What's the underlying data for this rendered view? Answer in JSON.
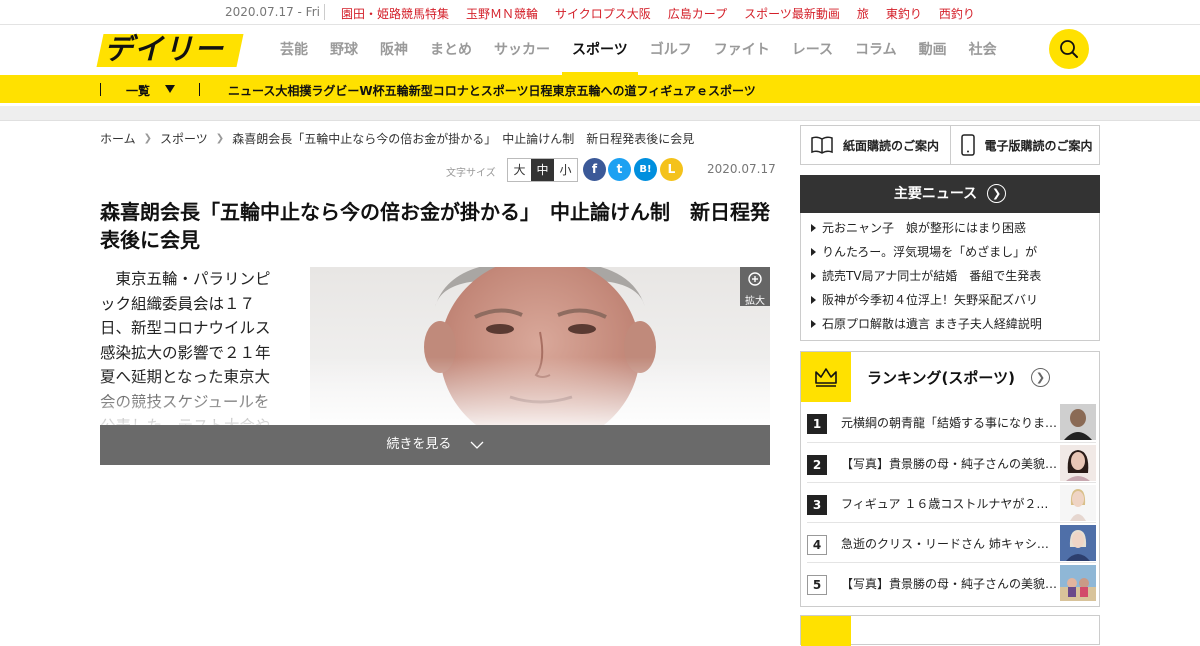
{
  "topbar": {
    "date": "2020.07.17 - Fri",
    "links": [
      "園田・姫路競馬特集",
      "玉野ＭＮ競輪",
      "サイクロプス大阪",
      "広島カープ",
      "スポーツ最新動画",
      "旅",
      "東釣り",
      "西釣り"
    ]
  },
  "header": {
    "logo": "デイリー",
    "nav": [
      "芸能",
      "野球",
      "阪神",
      "まとめ",
      "サッカー",
      "スポーツ",
      "ゴルフ",
      "ファイト",
      "レース",
      "コラム",
      "動画",
      "社会"
    ],
    "active_nav": "スポーツ"
  },
  "subnav": {
    "ichiran": "一覧",
    "items": [
      "ニュース",
      "大相撲",
      "ラグビーW杯",
      "五輪",
      "新型コロナとスポーツ日程",
      "東京五輪への道",
      "フィギュア",
      "ｅスポーツ"
    ]
  },
  "breadcrumb": [
    "ホーム",
    "スポーツ",
    "森喜朗会長「五輪中止なら今の倍お金が掛かる」　中止論けん制　新日程発表後に会見"
  ],
  "toolbar": {
    "font_size_label": "文字サイズ",
    "font_sizes": [
      "大",
      "中",
      "小"
    ],
    "share": {
      "facebook": "f",
      "twitter": "t",
      "hatena": "B!",
      "line": "L"
    },
    "date": "2020.07.17"
  },
  "article": {
    "title": "森喜朗会長「五輪中止なら今の倍お金が掛かる」　中止論けん制　新日程発表後に会見",
    "body": "東京五輪・パラリンピック組織委員会は１７日、新型コロナウイルス感染拡大の影響で２１年夏へ延期となった東京大会の競技スケジュールを公表した。テスト大会や",
    "zoom_label": "拡大",
    "continue_label": "続きを見る"
  },
  "sidebar": {
    "subscribe": [
      "紙面購読のご案内",
      "電子版購読のご案内"
    ],
    "news_heading": "主要ニュース",
    "news": [
      "元おニャン子　娘が整形にはまり困惑",
      "りんたろー。浮気現場を「めざまし」が",
      "読売TV局アナ同士が結婚　番組で生発表",
      "阪神が今季初４位浮上！矢野采配ズバリ",
      "石原プロ解散は遺言 まき子夫人経緯説明"
    ],
    "ranking_heading": "ランキング(スポーツ)",
    "ranking": [
      {
        "rank": "1",
        "title": "元横綱の朝青龍「結婚する事になりま…"
      },
      {
        "rank": "2",
        "title": "【写真】貴景勝の母・純子さんの美貌…"
      },
      {
        "rank": "3",
        "title": "フィギュア １６歳コストルナヤが２…"
      },
      {
        "rank": "4",
        "title": "急逝のクリス・リードさん 姉キャシ…"
      },
      {
        "rank": "5",
        "title": "【写真】貴景勝の母・純子さんの美貌…"
      }
    ]
  },
  "colors": {
    "brand_yellow": "#ffe100",
    "top_link_red": "#d4202a",
    "dark": "#333333"
  }
}
